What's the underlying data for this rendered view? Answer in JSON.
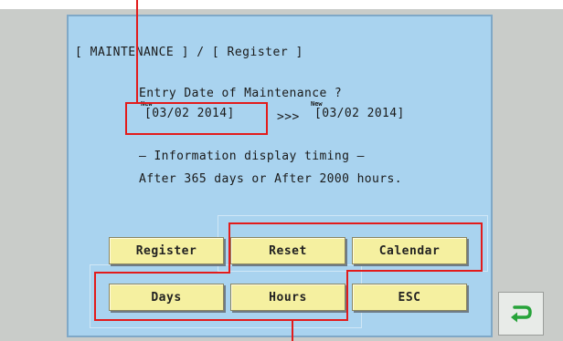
{
  "header": {
    "title": "[ MAINTENANCE ] / [ Register ]"
  },
  "body": {
    "question": "Entry Date of Maintenance ?",
    "new_tag": "New",
    "current_date": "[03/02 2014]",
    "arrow": ">>>",
    "next_date": "[03/02 2014]",
    "info_heading": "– Information display timing –",
    "info_detail": "After 365 days or After 2000 hours."
  },
  "buttons": {
    "register": "Register",
    "reset": "Reset",
    "calendar": "Calendar",
    "days": "Days",
    "hours": "Hours",
    "esc": "ESC"
  },
  "icons": {
    "back": "back-arrow-icon"
  },
  "colors": {
    "screen_bg": "#a9d3ef",
    "button_bg": "#f5f0a0",
    "highlight": "#e21b1b",
    "back_icon": "#27a33a"
  }
}
